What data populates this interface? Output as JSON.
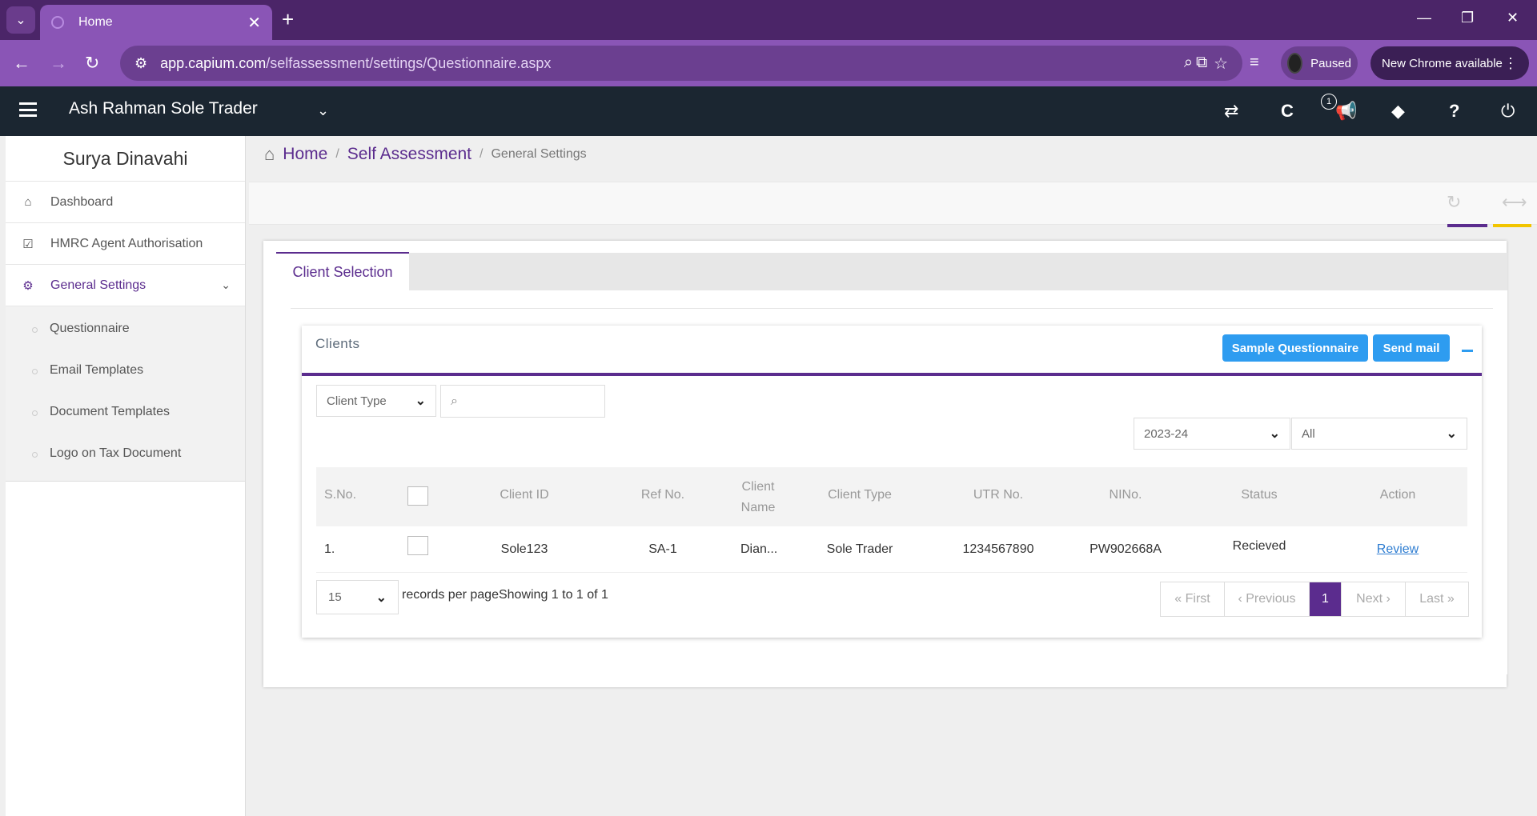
{
  "browser": {
    "tab_title": "Home",
    "url_domain": "app.capium.com",
    "url_path": "/selfassessment/settings/Questionnaire.aspx",
    "profile_status": "Paused",
    "update_label": "New Chrome available"
  },
  "header": {
    "company": "Ash Rahman Sole Trader",
    "notification_count": "1"
  },
  "sidebar": {
    "user_name": "Surya Dinavahi",
    "items": [
      {
        "label": "Dashboard",
        "icon": "home-icon"
      },
      {
        "label": "HMRC Agent Authorisation",
        "icon": "checkbox-icon"
      },
      {
        "label": "General Settings",
        "icon": "gears-icon"
      }
    ],
    "sub_items": [
      "Questionnaire",
      "Email Templates",
      "Document Templates",
      "Logo on Tax Document"
    ]
  },
  "breadcrumb": {
    "home": "Home",
    "section": "Self Assessment",
    "current": "General Settings",
    "sep": "/"
  },
  "main": {
    "tab_label": "Client Selection",
    "panel_title": "Clients",
    "sample_button": "Sample Questionnaire",
    "send_button": "Send mail",
    "client_type_select": "Client Type",
    "year_select": "2023-24",
    "status_select": "All",
    "columns": [
      "S.No.",
      "Client ID",
      "Ref No.",
      "Client Name",
      "Client Type",
      "UTR No.",
      "NINo.",
      "Status",
      "Action"
    ],
    "rows": [
      {
        "sno": "1.",
        "client_id": "Sole123",
        "ref": "SA-1",
        "name": "Dian...",
        "type": "Sole Trader",
        "utr": "1234567890",
        "nino": "PW902668A",
        "status": "Recieved",
        "action": "Review"
      }
    ],
    "per_page": "15",
    "records_label": "records per page",
    "showing": "Showing 1 to 1 of 1",
    "pager": {
      "first": "« First",
      "prev": "‹ Previous",
      "page": "1",
      "next": "Next ›",
      "last": "Last »"
    }
  },
  "colors": {
    "accent": "#5b2c8e",
    "button": "#2e9cf0",
    "header": "#1b2631",
    "chrome": "#8a55b6"
  }
}
